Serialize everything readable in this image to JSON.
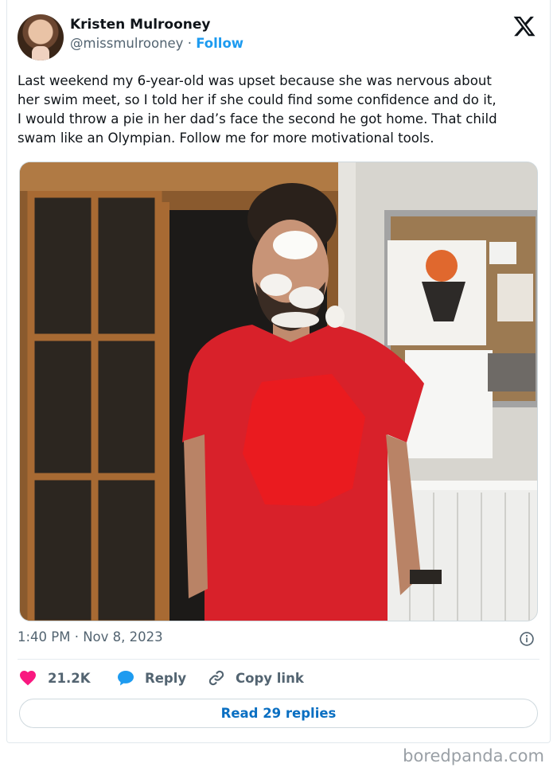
{
  "author": {
    "name": "Kristen Mulrooney",
    "handle": "@missmulrooney",
    "separator": "·",
    "follow_label": "Follow"
  },
  "tweet": {
    "text": "Last weekend my 6-year-old was upset because she was nervous about\nher swim meet, so I told her if she could find some confidence and do it,\nI would throw a pie in her dad’s face the second he got home. That child\nswam like an Olympian. Follow me for more motivational tools.",
    "timestamp": "1:40 PM · Nov 8, 2023"
  },
  "photo": {
    "icon": "photo-man-pie-face"
  },
  "actions": {
    "likes": "21.2K",
    "reply_label": "Reply",
    "copy_link_label": "Copy link"
  },
  "read_replies_label": "Read 29 replies",
  "watermark": "boredpanda.com",
  "colors": {
    "accent": "#1d9bf0",
    "heart": "#f91880",
    "reply_bubble": "#1d9bf0",
    "read_replies_text": "#0a6fc2",
    "secondary_text": "#536471"
  }
}
